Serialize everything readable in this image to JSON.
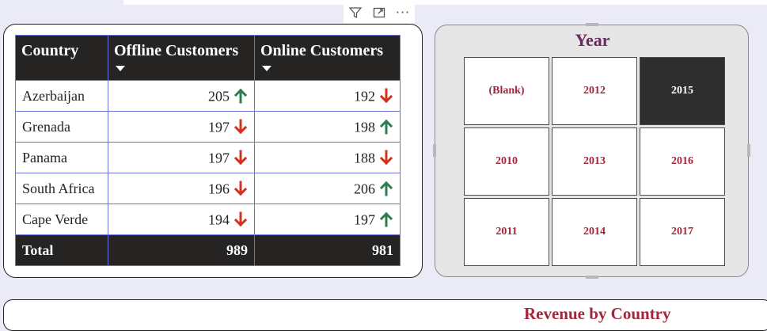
{
  "table": {
    "headers": [
      "Country",
      "Offline Customers",
      "Online Customers"
    ],
    "rows": [
      {
        "country": "Azerbaijan",
        "offline": "205",
        "offline_trend": "up",
        "online": "192",
        "online_trend": "down"
      },
      {
        "country": "Grenada",
        "offline": "197",
        "offline_trend": "down",
        "online": "198",
        "online_trend": "up"
      },
      {
        "country": "Panama",
        "offline": "197",
        "offline_trend": "down",
        "online": "188",
        "online_trend": "down"
      },
      {
        "country": "South Africa",
        "offline": "196",
        "offline_trend": "down",
        "online": "206",
        "online_trend": "up"
      },
      {
        "country": "Cape Verde",
        "offline": "194",
        "offline_trend": "down",
        "online": "197",
        "online_trend": "up"
      }
    ],
    "total": {
      "label": "Total",
      "offline": "989",
      "online": "981"
    }
  },
  "slicer": {
    "title": "Year",
    "options": [
      "(Blank)",
      "2012",
      "2015",
      "2010",
      "2013",
      "2016",
      "2011",
      "2014",
      "2017"
    ],
    "selected": "2015"
  },
  "bottom_visual": {
    "title": "Revenue by Country"
  },
  "visual_header": {
    "filter_icon": "filter-icon",
    "focus_icon": "focus-mode-icon",
    "more_label": "···"
  },
  "colors": {
    "up": "#2e7d4f",
    "down": "#d2321f",
    "header_bg": "#252423",
    "tile_text": "#a3263c",
    "title_text": "#6b2a5e"
  }
}
